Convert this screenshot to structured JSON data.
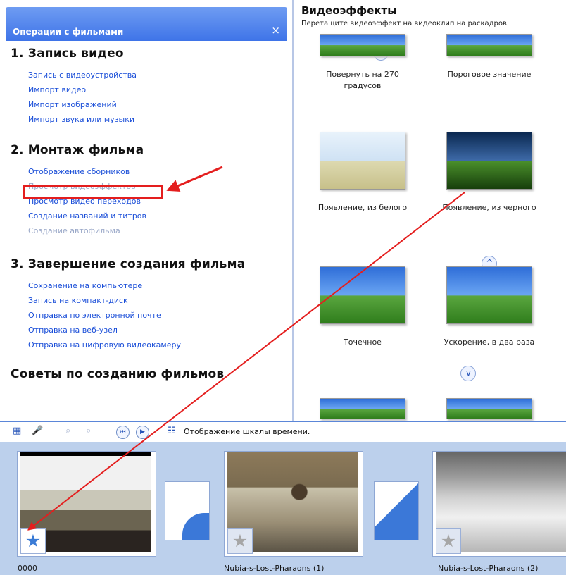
{
  "tasks": {
    "header_title": "Операции с фильмами",
    "close_symbol": "×",
    "sections": [
      {
        "title": "1. Запись видео",
        "collapse_icon": "^",
        "links": [
          "Запись с видеоустройства",
          "Импорт видео",
          "Импорт изображений",
          "Импорт звука или музыки"
        ]
      },
      {
        "title": "2. Монтаж фильма",
        "collapse_icon": "^",
        "links": [
          "Отображение сборников",
          "Просмотр видеоэффектов",
          "Просмотр видео переходов",
          "Создание названий и титров",
          "Создание автофильма"
        ]
      },
      {
        "title": "3. Завершение создания фильма",
        "collapse_icon": "^",
        "links": [
          "Сохранение на компьютере",
          "Запись на компакт-диск",
          "Отправка по электронной почте",
          "Отправка на веб-узел",
          "Отправка на цифровую видеокамеру"
        ]
      },
      {
        "title": "Советы по созданию фильмов",
        "collapse_icon": "v",
        "links": []
      }
    ]
  },
  "effects": {
    "title": "Видеоэффекты",
    "subtitle": "Перетащите видеоэффект на видеоклип на раскадров",
    "items": [
      {
        "label": "Повернуть на 270 градусов"
      },
      {
        "label": "Пороговое значение"
      },
      {
        "label": "Появление, из белого"
      },
      {
        "label": "Появление, из черного"
      },
      {
        "label": "Точечное"
      },
      {
        "label": "Ускорение, в два раза"
      }
    ]
  },
  "toolbar": {
    "timeline_label": "Отображение шкалы времени."
  },
  "storyboard": {
    "clips": [
      {
        "label": "0000"
      },
      {
        "label": "Nubia-s-Lost-Pharaons (1)"
      },
      {
        "label": "Nubia-s-Lost-Pharaons (2)"
      }
    ]
  },
  "colors": {
    "highlight": "#e41e1e",
    "link": "#1a4ed8",
    "storyboard_bg": "#bcd0ec"
  }
}
